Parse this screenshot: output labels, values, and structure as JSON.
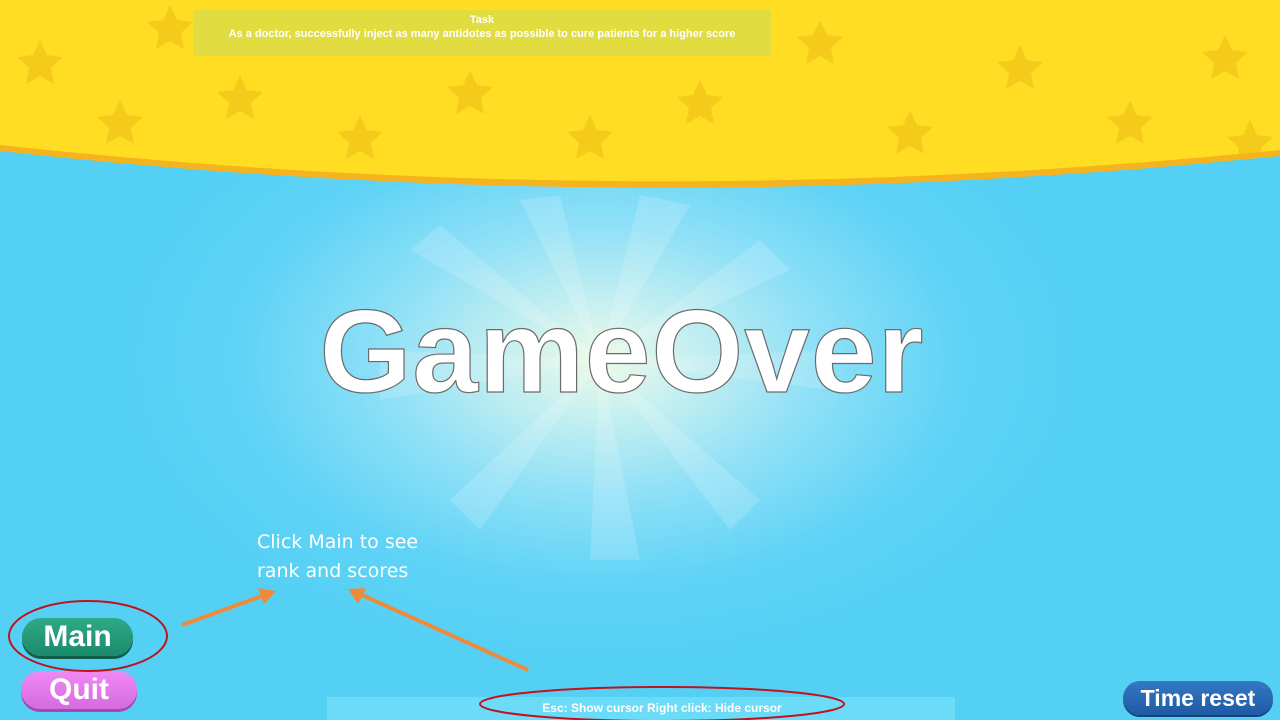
{
  "task": {
    "heading": "Task",
    "description": "As a doctor, successfully inject as many antidotes as possible to cure patients for a higher score"
  },
  "screen": {
    "title": "GameOver"
  },
  "annotation": {
    "hint_line1": "Click Main to see",
    "hint_line2": "rank and scores"
  },
  "buttons": {
    "main_label": "Main",
    "quit_label": "Quit",
    "time_reset_label": "Time reset"
  },
  "footer": {
    "controls_hint": "Esc: Show cursor  Right click: Hide cursor"
  },
  "colors": {
    "sky": "#55d2f5",
    "top_band": "#ffdd22",
    "top_band_edge": "#f5b41e",
    "main_button": "#1b8a6c",
    "quit_button": "#d66ae0",
    "time_reset_button": "#1f5aa4",
    "annotation_red": "#c0121e",
    "annotation_arrow": "#ef8a3a"
  },
  "icons": {
    "band_decoration": "star-icon",
    "annotation_pointer": "arrow-icon"
  }
}
